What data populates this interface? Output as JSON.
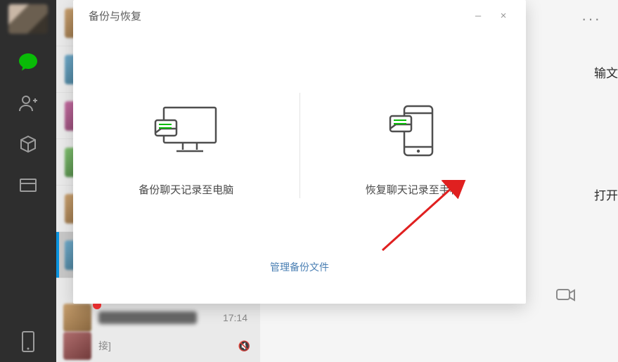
{
  "modal": {
    "title": "备份与恢复",
    "backup_label": "备份聊天记录至电脑",
    "restore_label": "恢复聊天记录至手机",
    "manage_link": "管理备份文件",
    "minimize": "–",
    "close": "×"
  },
  "main": {
    "more": "···",
    "side_text_1": "输文",
    "side_text_2": "打开"
  },
  "chat": {
    "sample_time": "17:14",
    "sample_suffix": "接]"
  },
  "icons": {
    "chat": "chat-icon",
    "contacts": "contacts-icon",
    "favorites": "favorites-icon",
    "files": "files-icon",
    "phone": "phone-icon",
    "call": "call-icon",
    "monitor": "monitor-icon",
    "mobile": "mobile-icon"
  }
}
